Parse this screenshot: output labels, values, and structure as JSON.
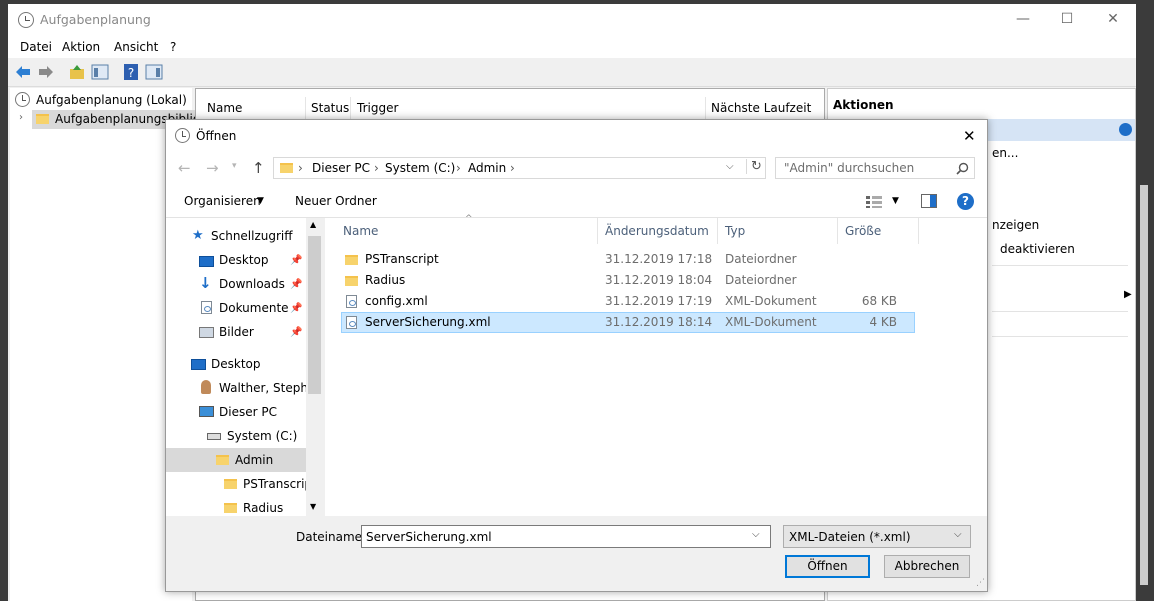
{
  "main": {
    "title": "Aufgabenplanung",
    "window_controls": {
      "minimize": "—",
      "maximize": "☐",
      "close": "✕"
    },
    "menu": [
      "Datei",
      "Aktion",
      "Ansicht",
      "?"
    ],
    "tree": {
      "root": "Aufgabenplanung (Lokal)",
      "child": "Aufgabenplanungsbibliot"
    },
    "columns": [
      "Name",
      "Status",
      "Trigger",
      "Nächste Laufzeit"
    ],
    "actions": {
      "header": "Aktionen",
      "fragments": [
        "en...",
        "nzeigen",
        "deaktivieren"
      ]
    }
  },
  "dialog": {
    "title": "Öffnen",
    "close": "✕",
    "address": {
      "crumbs": [
        "Dieser PC",
        "System (C:)",
        "Admin"
      ],
      "separator": "›"
    },
    "search_placeholder": "\"Admin\" durchsuchen",
    "toolbar": {
      "organize": "Organisieren",
      "new_folder": "Neuer Ordner",
      "help": "?"
    },
    "nav": {
      "quick_access": "Schnellzugriff",
      "items": [
        {
          "label": "Desktop"
        },
        {
          "label": "Downloads"
        },
        {
          "label": "Dokumente"
        },
        {
          "label": "Bilder"
        }
      ],
      "desktop": "Desktop",
      "user": "Walther, Stephan",
      "this_pc": "Dieser PC",
      "drive": "System (C:)",
      "admin": "Admin",
      "psts": "PSTranscript",
      "radius": "Radius"
    },
    "columns": {
      "name": "Name",
      "date": "Änderungsdatum",
      "type": "Typ",
      "size": "Größe"
    },
    "files": [
      {
        "name": "PSTranscript",
        "date": "31.12.2019 17:18",
        "type": "Dateiordner",
        "size": ""
      },
      {
        "name": "Radius",
        "date": "31.12.2019 18:04",
        "type": "Dateiordner",
        "size": ""
      },
      {
        "name": "config.xml",
        "date": "31.12.2019 17:19",
        "type": "XML-Dokument",
        "size": "68 KB"
      },
      {
        "name": "ServerSicherung.xml",
        "date": "31.12.2019 18:14",
        "type": "XML-Dokument",
        "size": "4 KB"
      }
    ],
    "filename_label": "Dateiname:",
    "filename_value": "ServerSicherung.xml",
    "filetype": "XML-Dateien (*.xml)",
    "open_button": "Öffnen",
    "cancel_button": "Abbrechen",
    "colors": {
      "selected_row": "#cce8ff",
      "selected_border": "#99d1ff",
      "help_blue": "#1e6ec8"
    }
  }
}
